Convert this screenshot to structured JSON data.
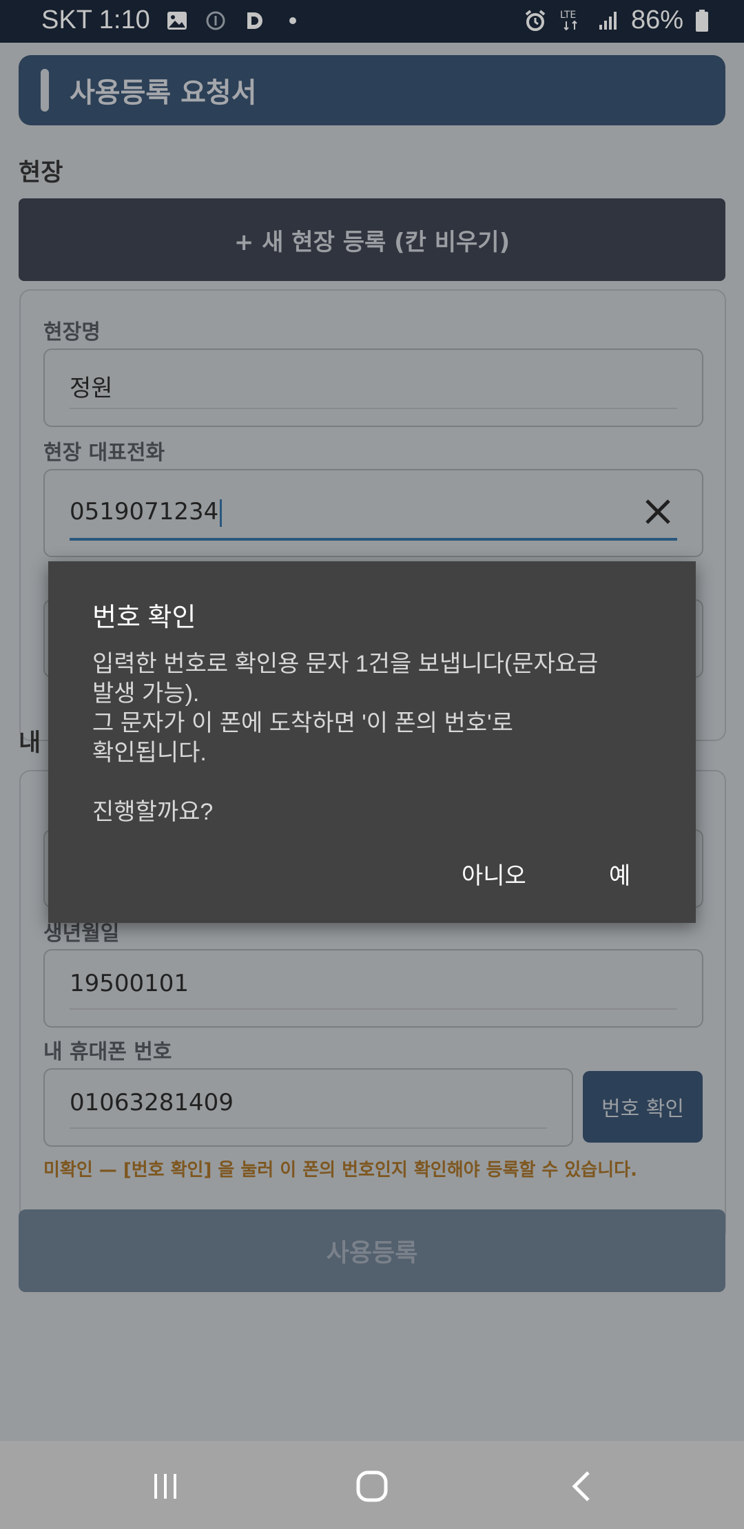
{
  "status_bar": {
    "carrier_time": "SKT 1:10",
    "network": "LTE",
    "battery": "86%"
  },
  "header": {
    "title": "사용등록 요청서"
  },
  "site_section": {
    "label": "현장",
    "new_site_button": "+ 새 현장 등록 (칸 비우기)",
    "site_name_label": "현장명",
    "site_name_value": "정원",
    "site_phone_label": "현장 대표전화",
    "site_phone_value": "0519071234"
  },
  "my_section": {
    "label": "내",
    "birthdate_label": "생년월일",
    "birthdate_value": "19500101",
    "phone_label": "내 휴대폰 번호",
    "phone_value": "01063281409",
    "verify_button": "번호 확인",
    "warning": "미확인 — [번호 확인] 을 눌러 이 폰의 번호인지 확인해야 등록할 수 있습니다."
  },
  "submit_button": "사용등록",
  "dialog": {
    "title": "번호 확인",
    "line1": "입력한 번호로 확인용 문자 1건을 보냅니다(문자요금",
    "line2": "발생 가능).",
    "line3": "그 문자가 이 폰에 도착하면 '이 폰의 번호'로",
    "line4": "확인됩니다.",
    "line5": "진행할까요?",
    "no_button": "아니오",
    "yes_button": "예"
  }
}
